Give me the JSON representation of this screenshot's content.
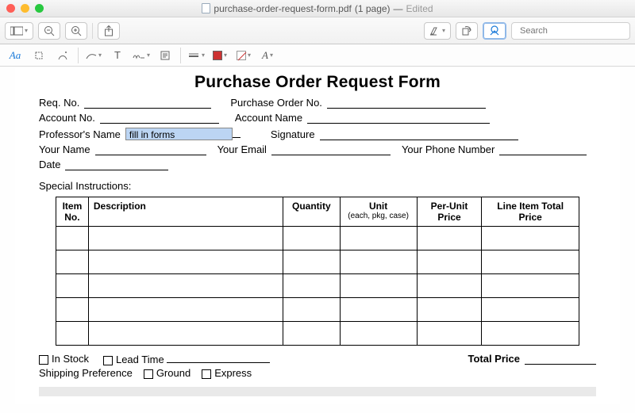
{
  "window": {
    "filename": "purchase-order-request-form.pdf",
    "pages": "(1 page)",
    "status": "Edited"
  },
  "toolbar": {
    "search_placeholder": "Search"
  },
  "markup": {
    "text_tool": "Aa",
    "glyph_T": "T",
    "glyph_A": "A"
  },
  "form": {
    "title": "Purchase Order Request Form",
    "labels": {
      "req_no": "Req. No.",
      "po_no": "Purchase Order No.",
      "account_no": "Account No.",
      "account_name": "Account Name",
      "professor_name": "Professor's Name",
      "signature": "Signature",
      "your_name": "Your Name",
      "your_email": "Your Email",
      "your_phone": "Your Phone Number",
      "date": "Date",
      "special": "Special Instructions:",
      "in_stock": "In Stock",
      "lead_time": "Lead Time",
      "total_price": "Total Price",
      "shipping_pref": "Shipping Preference",
      "ground": "Ground",
      "express": "Express"
    },
    "values": {
      "professor_name": "fill in forms"
    },
    "table": {
      "headers": {
        "item_no": "Item No.",
        "description": "Description",
        "quantity": "Quantity",
        "unit": "Unit",
        "unit_sub": "(each, pkg, case)",
        "per_unit_price": "Per-Unit Price",
        "line_total": "Line Item Total Price"
      },
      "row_count": 5
    }
  }
}
